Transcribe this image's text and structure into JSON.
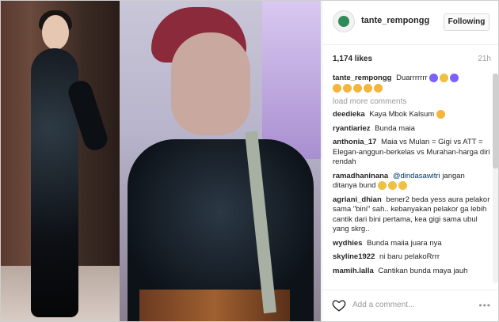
{
  "post": {
    "username": "tante_rempongg",
    "follow_label": "Following",
    "likes": "1,174 likes",
    "time": "21h",
    "caption_user": "tante_rempongg",
    "caption_text": "Duarrrrrrr",
    "load_more": "load more comments",
    "add_comment_placeholder": "Add a comment...",
    "more_icon": "•••"
  },
  "comments": [
    {
      "user": "deedieka",
      "text": "Kaya Mbok Kalsum"
    },
    {
      "user": "ryantiariez",
      "text": "Bunda maia"
    },
    {
      "user": "anthonia_17",
      "text": "Maia vs Mulan = Gigi vs ATT = Elegan-anggun-berkelas vs Murahan-harga diri rendah"
    },
    {
      "user": "ramadhaninana",
      "mention": "@dindasawitri",
      "text": "jangan ditanya bund"
    },
    {
      "user": "agriani_dhian",
      "text": "bener2 beda yess aura pelakor sama \"bini\" sah.. kebanyakan pelakor ga lebih cantik dari bini pertama, kea gigi sama ubul yang skrg.."
    },
    {
      "user": "wydhies",
      "text": "Bunda maiia juara nya"
    },
    {
      "user": "skyline1922",
      "text": "ni baru pelakoRrrr"
    },
    {
      "user": "mamih.lalla",
      "text": "Cantikan bunda maya jauh"
    }
  ],
  "colors": {
    "text": "#262626",
    "muted": "#999999",
    "link": "#003569"
  },
  "icons": {
    "heart": "heart-icon",
    "avatar": "avatar",
    "more": "more-options-icon"
  }
}
